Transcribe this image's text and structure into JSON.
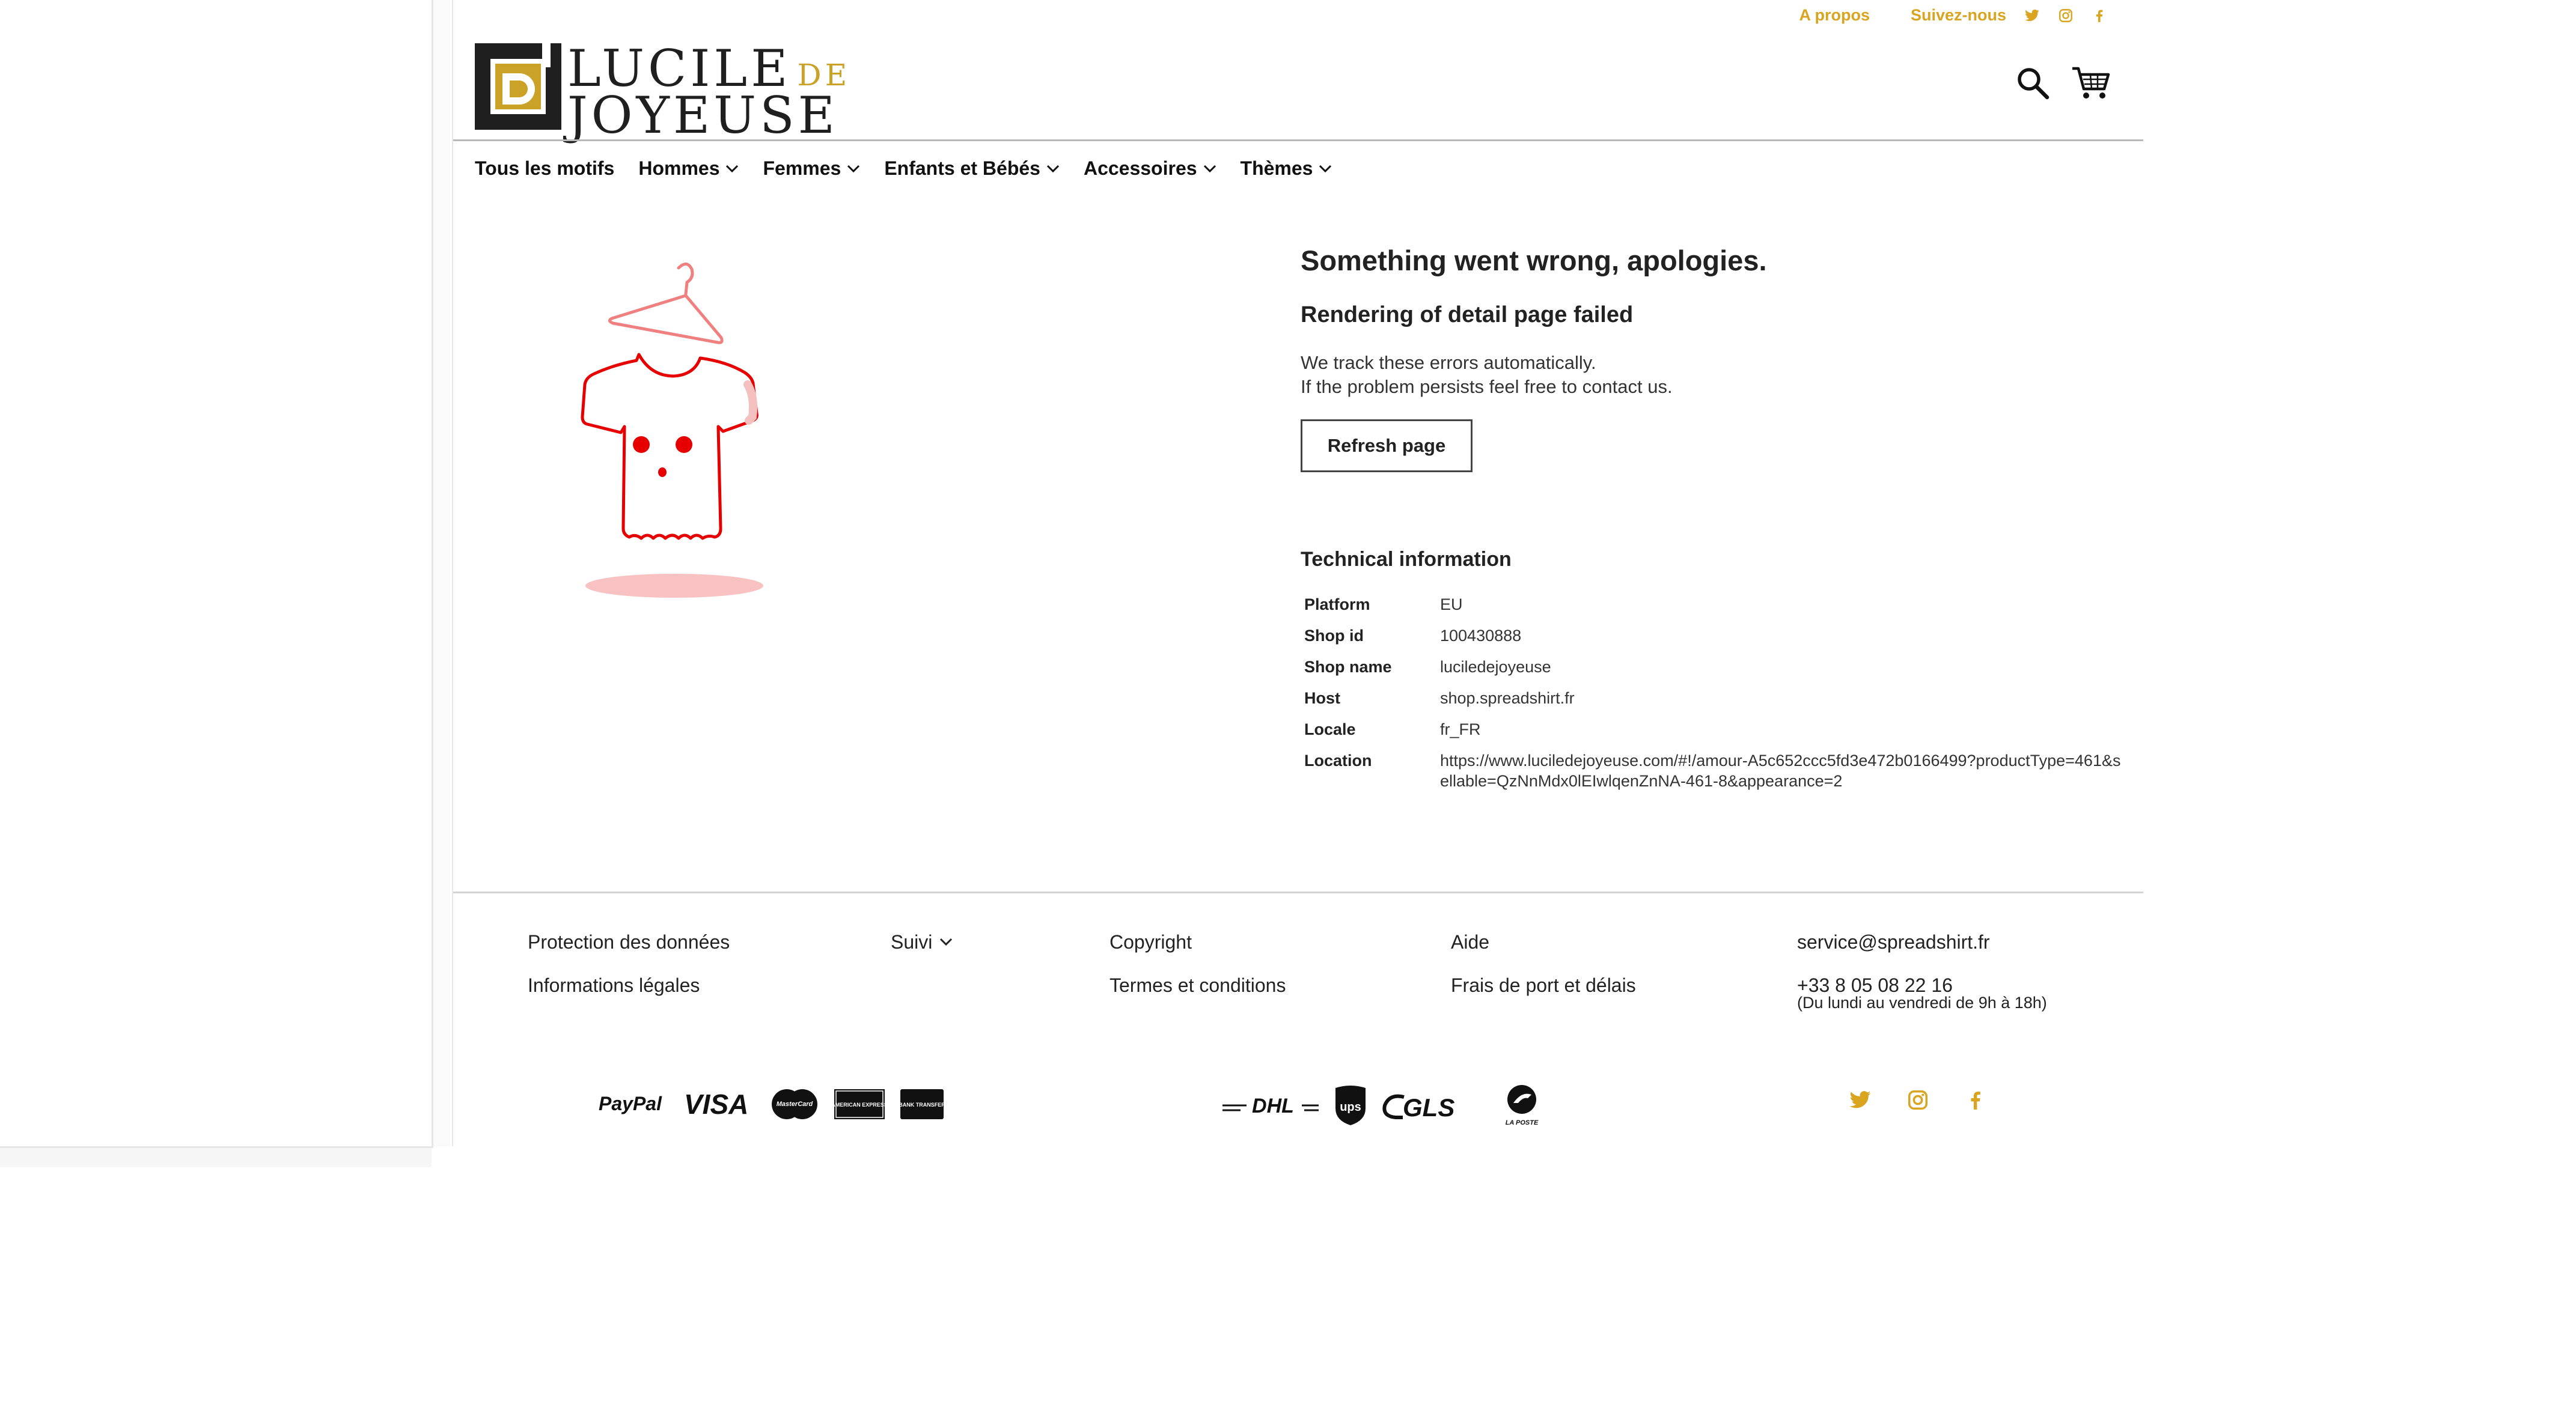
{
  "colors": {
    "accent": "#d9a520",
    "error_red": "#e60000",
    "text": "#1f1f1f",
    "border": "#444444"
  },
  "topbar": {
    "about": "A propos",
    "follow": "Suivez-nous",
    "social_icons": [
      "twitter-icon",
      "instagram-icon",
      "facebook-icon"
    ]
  },
  "logo": {
    "line1": "LUCILE",
    "line1_suffix": "DE",
    "line2": "JOYEUSE",
    "mark": "Dj"
  },
  "header_icons": [
    "search-icon",
    "cart-icon"
  ],
  "nav": {
    "items": [
      {
        "label": "Tous les motifs",
        "dropdown": false
      },
      {
        "label": "Hommes",
        "dropdown": true
      },
      {
        "label": "Femmes",
        "dropdown": true
      },
      {
        "label": "Enfants et Bébés",
        "dropdown": true
      },
      {
        "label": "Accessoires",
        "dropdown": true
      },
      {
        "label": "Thèmes",
        "dropdown": true
      }
    ]
  },
  "error": {
    "title": "Something went wrong, apologies.",
    "subtitle": "Rendering of detail page failed",
    "line1": "We track these errors automatically.",
    "line2": "If the problem persists feel free to contact us.",
    "refresh_label": "Refresh page",
    "tech_heading": "Technical information",
    "tech": [
      {
        "key": "Platform",
        "value": "EU"
      },
      {
        "key": "Shop id",
        "value": "100430888"
      },
      {
        "key": "Shop name",
        "value": "luciledejoyeuse"
      },
      {
        "key": "Host",
        "value": "shop.spreadshirt.fr"
      },
      {
        "key": "Locale",
        "value": "fr_FR"
      },
      {
        "key": "Location",
        "value": "https://www.luciledejoyeuse.com/#!/amour-A5c652ccc5fd3e472b0166499?productType=461&sellable=QzNnMdx0lEIwlqenZnNA-461-8&appearance=2"
      }
    ]
  },
  "footer": {
    "col1": [
      "Protection des données",
      "Informations légales"
    ],
    "col2": {
      "suivi_label": "Suivi"
    },
    "col3": [
      "Copyright",
      "Termes et conditions"
    ],
    "col4": [
      "Aide",
      "Frais de port et délais"
    ],
    "col5": {
      "email": "service@spreadshirt.fr",
      "phone": "+33 8 05 08 22 16",
      "hours": "(Du lundi au vendredi de 9h à 18h)"
    },
    "payment_logos": [
      "PayPal",
      "VISA",
      "MasterCard",
      "AMERICAN EXPRESS",
      "BANK TRANSFER"
    ],
    "shipping_logos": [
      "DHL",
      "ups",
      "GLS",
      "LA POSTE"
    ],
    "social_icons": [
      "twitter-icon",
      "instagram-icon",
      "facebook-icon"
    ]
  }
}
